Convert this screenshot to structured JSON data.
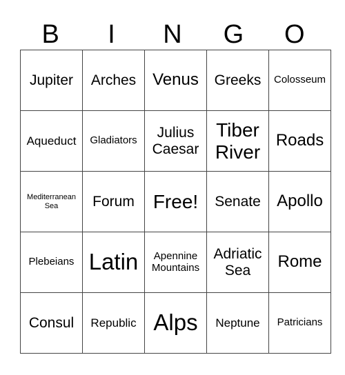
{
  "header": [
    "B",
    "I",
    "N",
    "G",
    "O"
  ],
  "rows": [
    [
      {
        "text": "Jupiter",
        "size": "lg"
      },
      {
        "text": "Arches",
        "size": "lg"
      },
      {
        "text": "Venus",
        "size": "xl"
      },
      {
        "text": "Greeks",
        "size": "lg"
      },
      {
        "text": "Colosseum",
        "size": "sm"
      }
    ],
    [
      {
        "text": "Aqueduct",
        "size": "md"
      },
      {
        "text": "Gladiators",
        "size": "sm"
      },
      {
        "text": "Julius Caesar",
        "size": "lg"
      },
      {
        "text": "Tiber River",
        "size": "xxl"
      },
      {
        "text": "Roads",
        "size": "xl"
      }
    ],
    [
      {
        "text": "Mediterranean Sea",
        "size": "xs"
      },
      {
        "text": "Forum",
        "size": "lg"
      },
      {
        "text": "Free!",
        "size": "xxl"
      },
      {
        "text": "Senate",
        "size": "lg"
      },
      {
        "text": "Apollo",
        "size": "xl"
      }
    ],
    [
      {
        "text": "Plebeians",
        "size": "sm"
      },
      {
        "text": "Latin",
        "size": "huge"
      },
      {
        "text": "Apennine Mountains",
        "size": "sm"
      },
      {
        "text": "Adriatic Sea",
        "size": "lg"
      },
      {
        "text": "Rome",
        "size": "xl"
      }
    ],
    [
      {
        "text": "Consul",
        "size": "lg"
      },
      {
        "text": "Republic",
        "size": "md"
      },
      {
        "text": "Alps",
        "size": "huge"
      },
      {
        "text": "Neptune",
        "size": "md"
      },
      {
        "text": "Patricians",
        "size": "sm"
      }
    ]
  ]
}
